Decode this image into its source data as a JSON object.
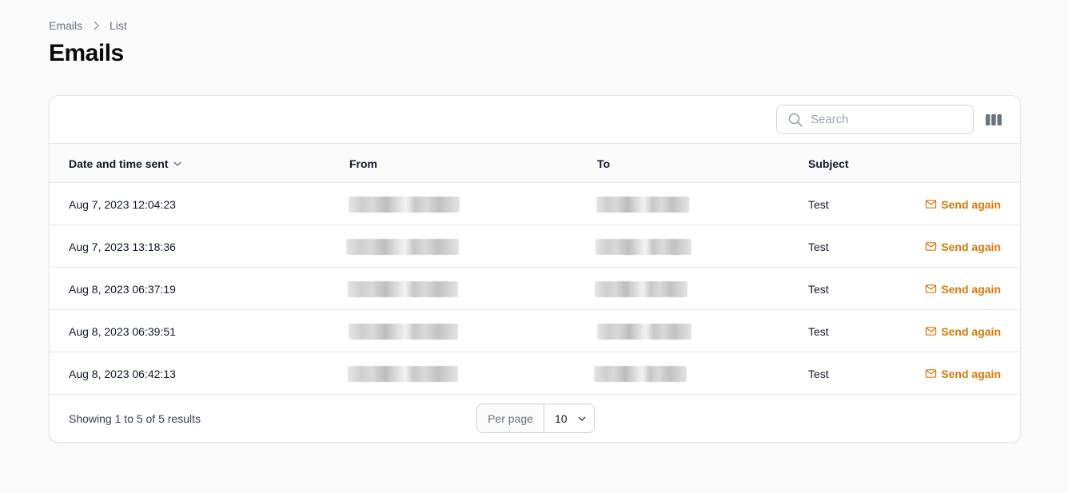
{
  "breadcrumb": {
    "items": [
      "Emails",
      "List"
    ]
  },
  "page": {
    "title": "Emails"
  },
  "search": {
    "placeholder": "Search",
    "value": ""
  },
  "table": {
    "columns": [
      "Date and time sent",
      "From",
      "To",
      "Subject"
    ],
    "sorted_column": "Date and time sent",
    "action_label": "Send again",
    "rows": [
      {
        "date": "Aug 7, 2023 12:04:23",
        "subject": "Test"
      },
      {
        "date": "Aug 7, 2023 13:18:36",
        "subject": "Test"
      },
      {
        "date": "Aug 8, 2023 06:37:19",
        "subject": "Test"
      },
      {
        "date": "Aug 8, 2023 06:39:51",
        "subject": "Test"
      },
      {
        "date": "Aug 8, 2023 06:42:13",
        "subject": "Test"
      }
    ]
  },
  "footer": {
    "showing": "Showing 1 to 5 of 5 results",
    "per_page_label": "Per page",
    "per_page_value": "10"
  },
  "colors": {
    "accent": "#d97706",
    "background": "#fafafa",
    "border": "#e5e7eb"
  },
  "icons": {
    "search": "search-icon",
    "columns": "columns-icon",
    "sort": "chevron-down-icon",
    "mail": "envelope-icon"
  }
}
